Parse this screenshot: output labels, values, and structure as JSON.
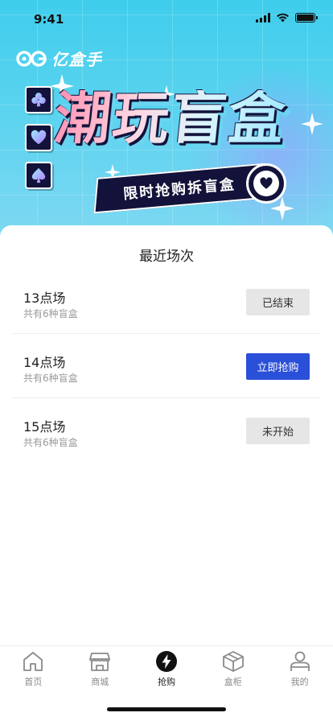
{
  "status_bar": {
    "time": "9:41"
  },
  "brand": {
    "name": "亿盒手"
  },
  "hero": {
    "title": "潮玩盲盒",
    "ribbon": "限时抢购拆盲盒",
    "suits": [
      "club-icon",
      "heart-icon",
      "spade-icon"
    ]
  },
  "section": {
    "title": "最近场次"
  },
  "sessions": [
    {
      "name": "13点场",
      "desc": "共有6种盲盒",
      "button": "已结束",
      "state": "ended"
    },
    {
      "name": "14点场",
      "desc": "共有6种盲盒",
      "button": "立即抢购",
      "state": "active"
    },
    {
      "name": "15点场",
      "desc": "共有6种盲盒",
      "button": "未开始",
      "state": "upcoming"
    }
  ],
  "tabbar": {
    "items": [
      {
        "label": "首页",
        "icon": "home-icon"
      },
      {
        "label": "商城",
        "icon": "store-icon"
      },
      {
        "label": "抢购",
        "icon": "lightning-icon",
        "active": true
      },
      {
        "label": "盒柜",
        "icon": "box-icon"
      },
      {
        "label": "我的",
        "icon": "user-icon"
      }
    ]
  },
  "colors": {
    "accent": "#2a4fd8",
    "hero_bg": "#3fcdec",
    "dark_navy": "#12123a",
    "disabled_btn": "#e6e6e6"
  }
}
